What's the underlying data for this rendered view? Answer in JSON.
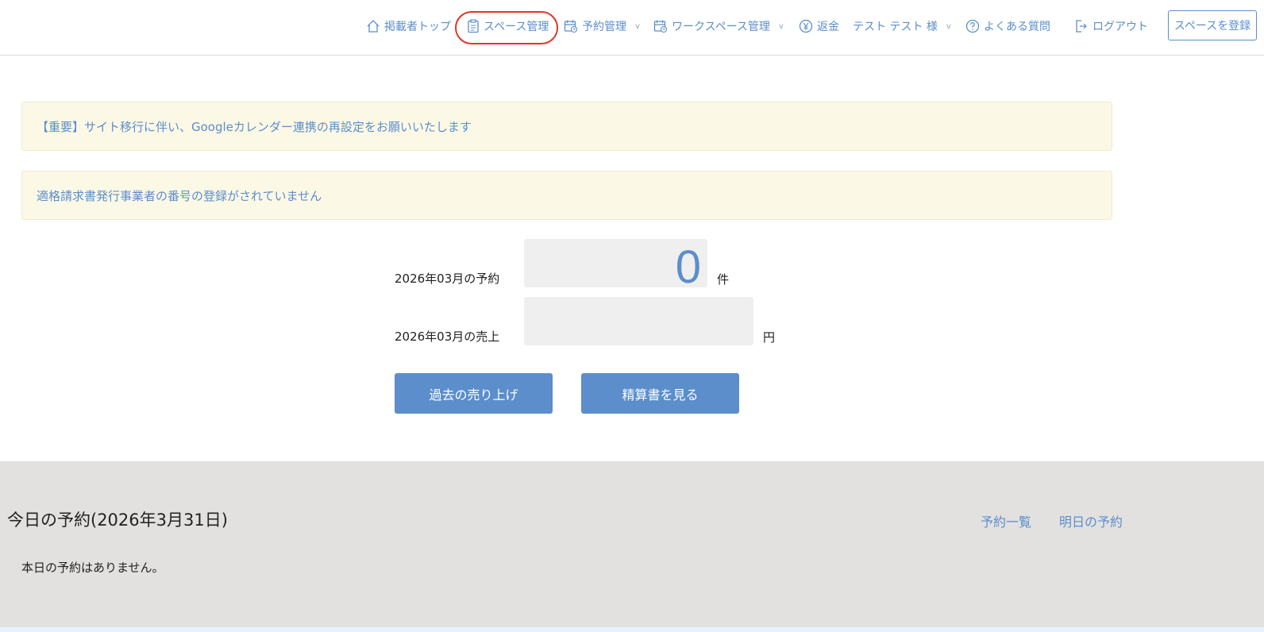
{
  "header": {
    "nav": {
      "top": "掲載者トップ",
      "space": "スペース管理",
      "booking": "予約管理",
      "workspace": "ワークスペース管理",
      "refund": "返金",
      "user": "テスト テスト 様",
      "faq": "よくある質問",
      "logout": "ログアウト"
    },
    "chevron": "v",
    "register_button": "スペースを登録",
    "accent_color": "#5b8ecb",
    "highlight_color": "#e0352b"
  },
  "notices": [
    "【重要】サイト移行に伴い、Googleカレンダー連携の再設定をお願いいたします",
    "適格請求書発行事業者の番号の登録がされていません"
  ],
  "stats": {
    "booking_label": "2026年03月の予約",
    "booking_value": "0",
    "booking_unit": "件",
    "sales_label": "2026年03月の売上",
    "sales_value": "",
    "sales_unit": "円"
  },
  "buttons": {
    "past_sales": "過去の売り上げ",
    "statement": "精算書を見る"
  },
  "today": {
    "title": "今日の予約(2026年3月31日)",
    "list_link": "予約一覧",
    "tomorrow_link": "明日の予約",
    "empty_message": "本日の予約はありません。"
  }
}
